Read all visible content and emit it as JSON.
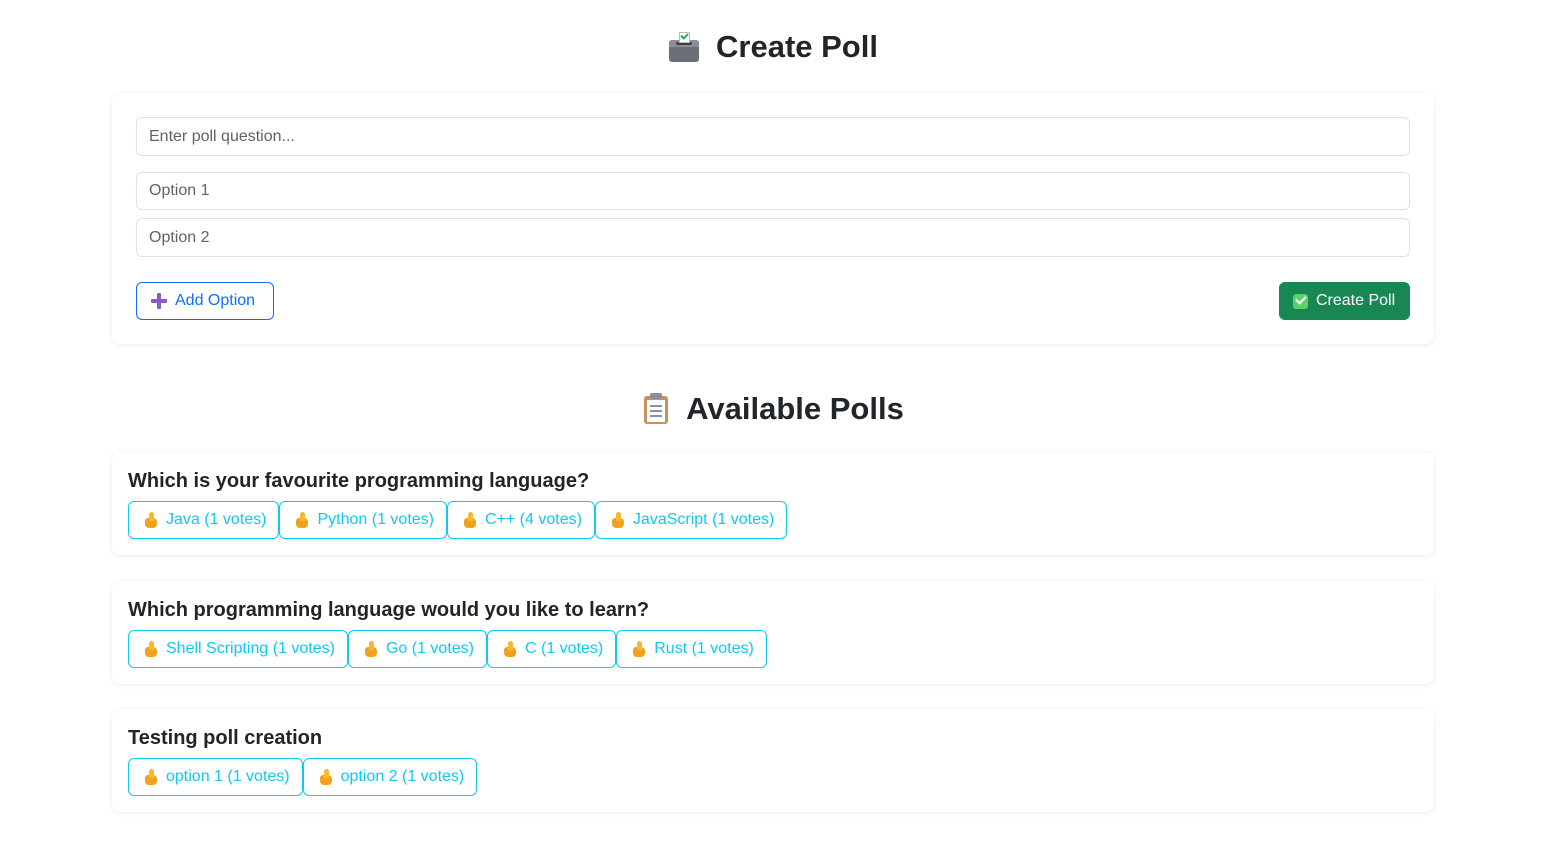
{
  "create_section": {
    "title": "Create Poll",
    "title_icon": "ballot-box-icon",
    "question_placeholder": "Enter poll question...",
    "option_placeholders": [
      "Option 1",
      "Option 2"
    ],
    "add_option_label": "Add Option",
    "create_button_label": "Create Poll"
  },
  "polls_section": {
    "title": "Available Polls",
    "title_icon": "clipboard-icon"
  },
  "polls": [
    {
      "question": "Which is your favourite programming language?",
      "options": [
        "Java (1 votes)",
        "Python (1 votes)",
        "C++ (4 votes)",
        "JavaScript (1 votes)"
      ]
    },
    {
      "question": "Which programming language would you like to learn?",
      "options": [
        "Shell Scripting (1 votes)",
        "Go (1 votes)",
        "C (1 votes)",
        "Rust (1 votes)"
      ]
    },
    {
      "question": "Testing poll creation",
      "options": [
        "option 1 (1 votes)",
        "option 2 (1 votes)"
      ]
    }
  ],
  "colors": {
    "primary": "#0d6efd",
    "success": "#198754",
    "info": "#0dcaf0"
  }
}
